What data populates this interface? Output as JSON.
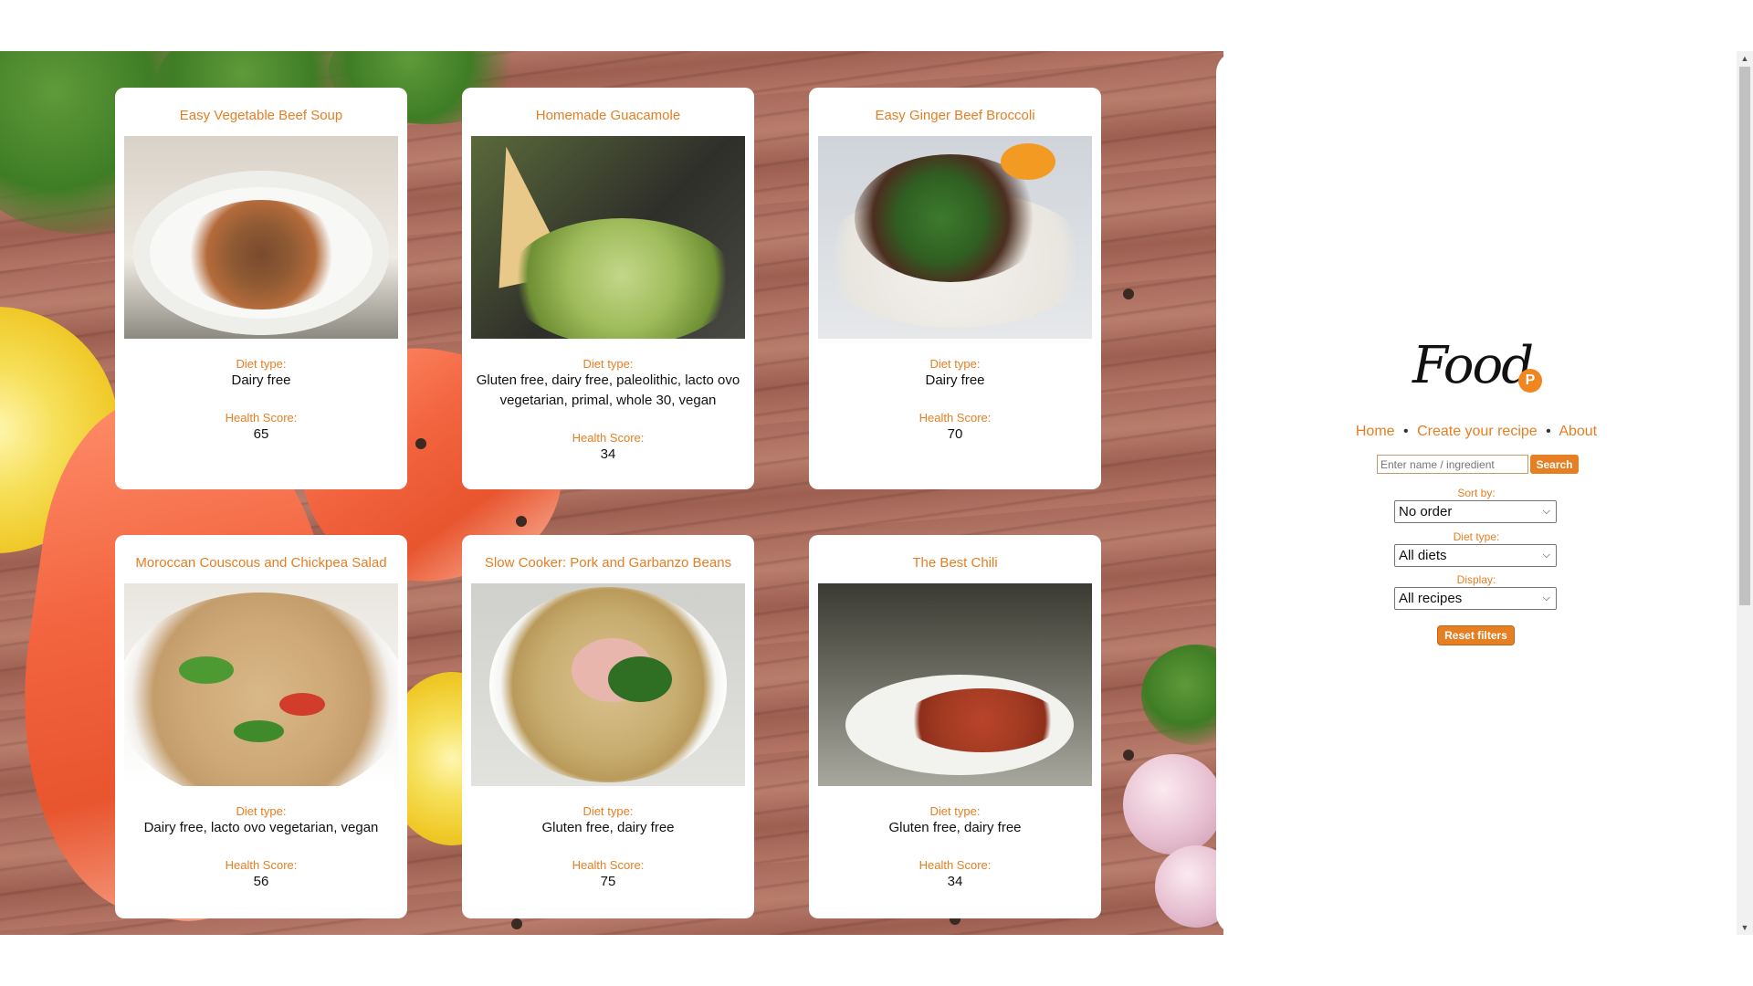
{
  "recipes": [
    {
      "title": "Easy Vegetable Beef Soup",
      "diet_label": "Diet type:",
      "diet": "Dairy free",
      "score_label": "Health Score:",
      "score": "65"
    },
    {
      "title": "Homemade Guacamole",
      "diet_label": "Diet type:",
      "diet": "Gluten free, dairy free, paleolithic, lacto ovo vegetarian, primal, whole 30, vegan",
      "score_label": "Health Score:",
      "score": "34"
    },
    {
      "title": "Easy Ginger Beef Broccoli",
      "diet_label": "Diet type:",
      "diet": "Dairy free",
      "score_label": "Health Score:",
      "score": "70"
    },
    {
      "title": "Moroccan Couscous and Chickpea Salad",
      "diet_label": "Diet type:",
      "diet": "Dairy free, lacto ovo vegetarian, vegan",
      "score_label": "Health Score:",
      "score": "56"
    },
    {
      "title": "Slow Cooker: Pork and Garbanzo Beans",
      "diet_label": "Diet type:",
      "diet": "Gluten free, dairy free",
      "score_label": "Health Score:",
      "score": "75"
    },
    {
      "title": "The Best Chili",
      "diet_label": "Diet type:",
      "diet": "Gluten free, dairy free",
      "score_label": "Health Score:",
      "score": "34"
    }
  ],
  "sidebar": {
    "logo_text": "Food",
    "logo_badge": "P",
    "nav": {
      "home": "Home",
      "create": "Create your recipe",
      "about": "About",
      "separator": "•"
    },
    "search": {
      "placeholder": "Enter name / ingredient",
      "button": "Search"
    },
    "filters": {
      "sort_label": "Sort by:",
      "sort_value": "No order",
      "diet_label": "Diet type:",
      "diet_value": "All diets",
      "display_label": "Display:",
      "display_value": "All recipes"
    },
    "reset": "Reset filters"
  },
  "scrollbar": {
    "up": "▲",
    "down": "▼"
  },
  "colors": {
    "accent": "#e67e22",
    "background_panel": "#ffffff"
  }
}
